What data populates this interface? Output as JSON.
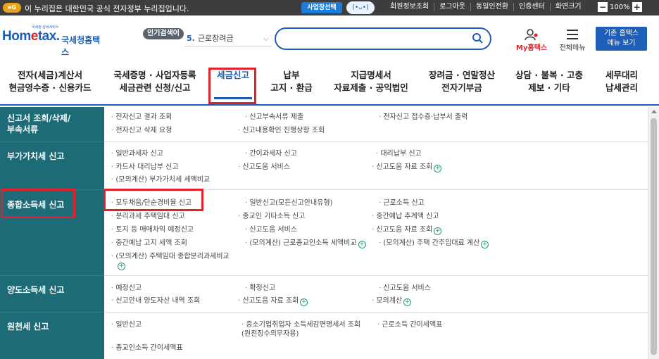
{
  "topbar": {
    "logo_text": "eG",
    "notice": "이 누리집은 대한민국 공식 전자정부 누리집입니다.",
    "biz_select": "사업장선택",
    "links": [
      "회원정보조회",
      "로그아웃",
      "동일인전환",
      "인증센터",
      "화면크기"
    ],
    "zoom_minus": "−",
    "zoom_value": "100%",
    "zoom_plus": "+"
  },
  "header": {
    "logo_main_pre": "Hom",
    "logo_main_e": "e",
    "logo_main_post": "tax.",
    "logo_kr": "국세청홈택스",
    "logo_small": "국세청 납세서비스",
    "hot_keyword_label": "인기검색어",
    "hot_keyword_num": "5.",
    "hot_keyword_text": "근로장려금",
    "my_hometax": "My홈택스",
    "all_menu": "전체메뉴",
    "old_menu": "기존 홈택스\n메뉴 보기"
  },
  "gnb": [
    {
      "label": "전자(세금)계산서\n현금영수증 · 신용카드"
    },
    {
      "label": "국세증명 · 사업자등록\n세금관련 신청/신고"
    },
    {
      "label": "세금신고"
    },
    {
      "label": "납부\n고지 · 환급"
    },
    {
      "label": "지급명세서\n자료제출 · 공익법인"
    },
    {
      "label": "장려금 · 연말정산\n전자기부금"
    },
    {
      "label": "상담 · 불복 · 고충\n제보 · 기타"
    },
    {
      "label": "세무대리\n납세관리"
    }
  ],
  "sidebar": [
    {
      "label": "신고서 조회/삭제/\n부속서류"
    },
    {
      "label": "부가가치세 신고"
    },
    {
      "label": "종합소득세 신고"
    },
    {
      "label": "양도소득세 신고"
    },
    {
      "label": "원천세 신고"
    }
  ],
  "sections": [
    {
      "links": [
        "전자신고 결과 조회",
        "신고부속서류 제출",
        "전자신고 접수증·납부서 출력",
        "전자신고 삭제 요청",
        "신고내용확인 진행상황 조회"
      ]
    },
    {
      "links": [
        "일반과세자 신고",
        "간이과세자 신고",
        "대리납부 신고",
        "카드사 대리납부 신고",
        "신고도움 서비스",
        "신고도움 자료 조회",
        "(모의계산) 부가가치세 세액비교"
      ]
    },
    {
      "links": [
        "모두채움/단순경비율 신고",
        "일반신고(모든신고안내유형)",
        "근로소득 신고",
        "분리과세 주택임대 신고",
        "종교인 기타소득 신고",
        "중간예납 추계액 신고",
        "토지 등 매매차익 예정신고",
        "신고도움 서비스",
        "신고도움 자료 조회",
        "중간예납 고지 세액 조회",
        "(모의계산) 근로종교인소득 세액비교",
        "(모의계산) 주택 간주임대료 계산",
        "(모의계산) 주택임대 종합분리과세비교"
      ]
    },
    {
      "links": [
        "예정신고",
        "확정신고",
        "신고도움 서비스",
        "신고안내 양도자산 내역 조회",
        "신고도움 자료 조회",
        "모의계산"
      ]
    },
    {
      "links": [
        "일반신고",
        "중소기업취업자 소득세감면명세서 조회\n(원천징수의무자용)",
        "근로소득 간이세액표",
        "종교인소득 간이세액표"
      ]
    }
  ],
  "plus_symbol": "+"
}
